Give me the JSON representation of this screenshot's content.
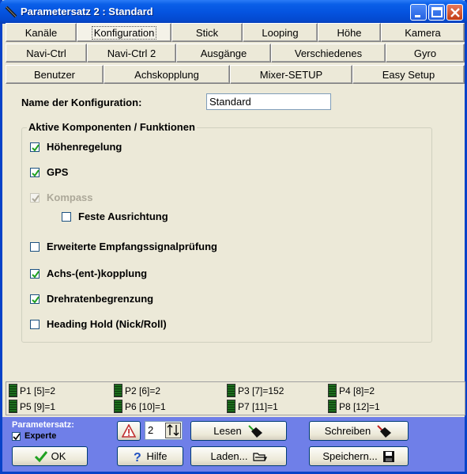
{
  "window": {
    "title": "Parametersatz 2 : Standard"
  },
  "tabs": {
    "row1": [
      "Kanäle",
      "Konfiguration",
      "Stick",
      "Looping",
      "Höhe",
      "Kamera"
    ],
    "row2": [
      "Navi-Ctrl",
      "Navi-Ctrl 2",
      "Ausgänge",
      "Verschiedenes",
      "Gyro"
    ],
    "row3": [
      "Benutzer",
      "Achskopplung",
      "Mixer-SETUP",
      "Easy Setup"
    ],
    "active": "Konfiguration"
  },
  "config": {
    "name_label": "Name der Konfiguration:",
    "name_value": "Standard",
    "group_title": "Aktive Komponenten / Funktionen",
    "options": [
      {
        "label": "Höhenregelung",
        "checked": true
      },
      {
        "label": "GPS",
        "checked": true
      },
      {
        "label": "Kompass",
        "checked": true,
        "disabled": true
      },
      {
        "label": "Feste Ausrichtung",
        "checked": false
      },
      {
        "label": "Erweiterte Empfangssignalprüfung",
        "checked": false
      },
      {
        "label": "Achs-(ent-)kopplung",
        "checked": true
      },
      {
        "label": "Drehratenbegrenzung",
        "checked": true
      },
      {
        "label": "Heading Hold (Nick/Roll)",
        "checked": false
      }
    ]
  },
  "poti_values": [
    "P1 [5]=2",
    "P2 [6]=2",
    "P3 [7]=152",
    "P4 [8]=2",
    "P5 [9]=1",
    "P6 [10]=1",
    "P7 [11]=1",
    "P8 [12]=1"
  ],
  "bottom": {
    "parametersatz_label": "Parametersatz:",
    "experte_label": "Experte",
    "experte_checked": true,
    "set_number": "2",
    "ok_label": "OK",
    "hilfe_label": "Hilfe",
    "lesen_label": "Lesen",
    "laden_label": "Laden...",
    "schreiben_label": "Schreiben",
    "speichern_label": "Speichern..."
  },
  "colors": {
    "titlebar": "#0554e0",
    "bottom_panel": "#6f7fe8",
    "window_bg": "#ece9d8"
  }
}
